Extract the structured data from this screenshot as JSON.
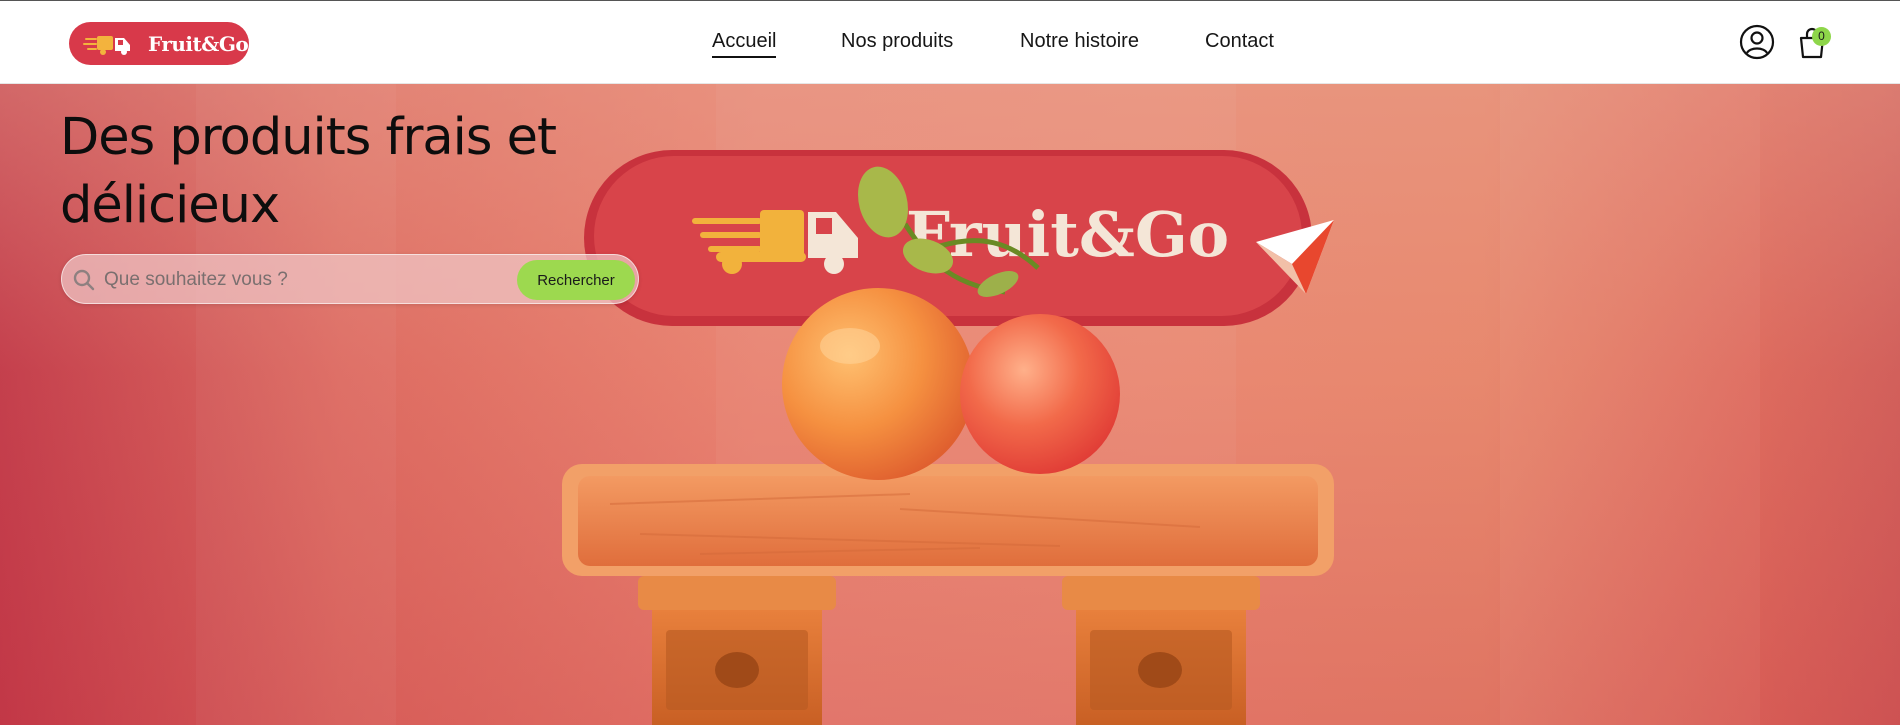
{
  "brand": {
    "name": "Fruit&Go",
    "color": "#d8394a"
  },
  "nav": {
    "items": [
      {
        "label": "Accueil",
        "active": true
      },
      {
        "label": "Nos produits",
        "active": false
      },
      {
        "label": "Notre histoire",
        "active": false
      },
      {
        "label": "Contact",
        "active": false
      }
    ]
  },
  "header_actions": {
    "account_icon": "user-circle-icon",
    "cart_icon": "shopping-bag-icon",
    "cart_count": "0"
  },
  "hero": {
    "title": "Des produits frais et délicieux",
    "search": {
      "placeholder": "Que souhaitez vous ?",
      "value": "",
      "button_label": "Rechercher"
    },
    "sign_text": "Fruit&Go"
  },
  "colors": {
    "accent_green": "#9dd94f",
    "hero_red": "#d8394a"
  }
}
